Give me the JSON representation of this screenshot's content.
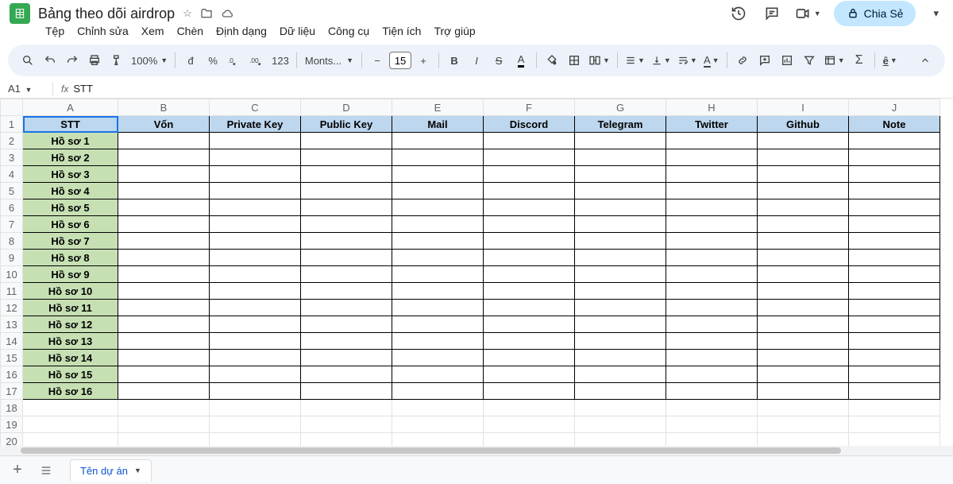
{
  "doc": {
    "title": "Bảng theo dõi airdrop"
  },
  "menu": {
    "file": "Tệp",
    "edit": "Chỉnh sửa",
    "view": "Xem",
    "insert": "Chèn",
    "format": "Định dạng",
    "data": "Dữ liệu",
    "tools": "Công cụ",
    "ext": "Tiện ích",
    "help": "Trợ giúp"
  },
  "toolbar": {
    "zoom": "100%",
    "currency": "đ",
    "percent": "%",
    "dec_dec": ".0",
    "dec_inc": ".00",
    "numfmt": "123",
    "font": "Monts...",
    "font_size": "15"
  },
  "namebox": "A1",
  "fx_value": "STT",
  "share_label": "Chia Sẻ",
  "columns": [
    "A",
    "B",
    "C",
    "D",
    "E",
    "F",
    "G",
    "H",
    "I",
    "J"
  ],
  "headers": {
    "A": "STT",
    "B": "Vốn",
    "C": "Private Key",
    "D": "Public Key",
    "E": "Mail",
    "F": "Discord",
    "G": "Telegram",
    "H": "Twitter",
    "I": "Github",
    "J": "Note"
  },
  "rows_a": [
    "Hồ sơ 1",
    "Hồ sơ 2",
    "Hồ sơ 3",
    "Hồ sơ 4",
    "Hồ sơ 5",
    "Hồ sơ 6",
    "Hồ sơ 7",
    "Hồ sơ 8",
    "Hồ sơ 9",
    "Hồ sơ 10",
    "Hồ sơ 11",
    "Hồ sơ 12",
    "Hồ sơ 13",
    "Hồ sơ 14",
    "Hồ sơ 15",
    "Hồ sơ 16"
  ],
  "blank_rows": 4,
  "sheet_tab": "Tên dự án"
}
